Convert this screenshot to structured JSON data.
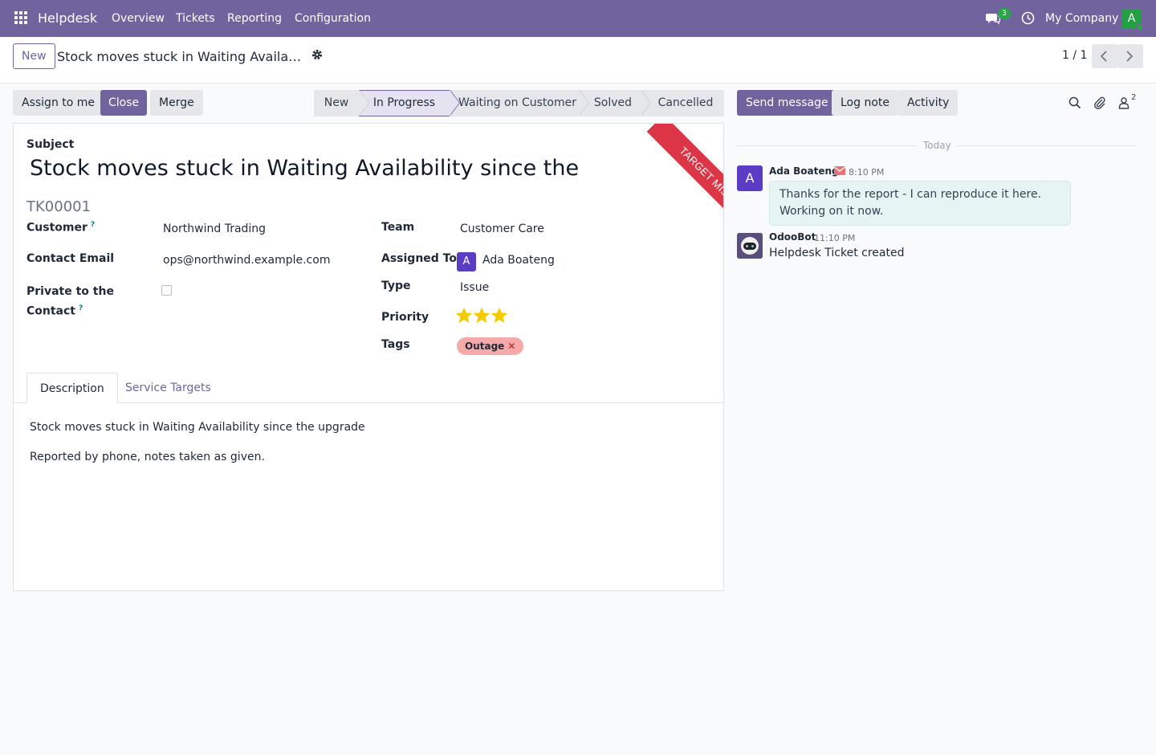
{
  "navbar": {
    "brand": "Helpdesk",
    "items": [
      "Overview",
      "Tickets",
      "Reporting",
      "Configuration"
    ],
    "chat_count": "3",
    "company": "My Company",
    "avatar_letter": "A"
  },
  "control": {
    "new_label": "New",
    "record_title": "Stock moves stuck in Waiting Availabili...",
    "pager": "1 / 1"
  },
  "actions": {
    "assign": "Assign to me",
    "close": "Close",
    "merge": "Merge"
  },
  "stages": [
    "New",
    "In Progress",
    "Waiting on Customer",
    "Solved",
    "Cancelled"
  ],
  "active_stage": "In Progress",
  "form": {
    "ribbon": "TARGET MISSED",
    "subject_label": "Subject",
    "subject": "Stock moves stuck in Waiting Availability since the",
    "ticket_ref": "TK00001",
    "customer_label": "Customer",
    "customer": "Northwind Trading",
    "email_label": "Contact Email",
    "email": "ops@northwind.example.com",
    "private_label_1": "Private to the",
    "private_label_2": "Contact",
    "private_checked": false,
    "team_label": "Team",
    "team": "Customer Care",
    "assigned_label": "Assigned To",
    "assigned_initial": "A",
    "assigned": "Ada Boateng",
    "type_label": "Type",
    "type": "Issue",
    "priority_label": "Priority",
    "priority_stars": 3,
    "tags_label": "Tags",
    "tag": "Outage",
    "tabs": [
      "Description",
      "Service Targets"
    ],
    "description_lines": [
      "Stock moves stuck in Waiting Availability since the upgrade",
      "Reported by phone, notes taken as given."
    ]
  },
  "chatter": {
    "send_message": "Send message",
    "log_note": "Log note",
    "activity": "Activity",
    "followers_count": "2",
    "date_separator": "Today",
    "messages": [
      {
        "author": "Ada Boateng",
        "initial": "A",
        "time": "8:10 PM",
        "body": "Thanks for the report - I can reproduce it here. Working on it now."
      },
      {
        "author": "OdooBot",
        "time": "11:10 PM",
        "body": "Helpdesk Ticket created"
      }
    ]
  },
  "colors": {
    "brand": "#71639e",
    "ribbon": "#dc3545",
    "star": "#f3cc00",
    "tag": "#f5a9a9"
  }
}
